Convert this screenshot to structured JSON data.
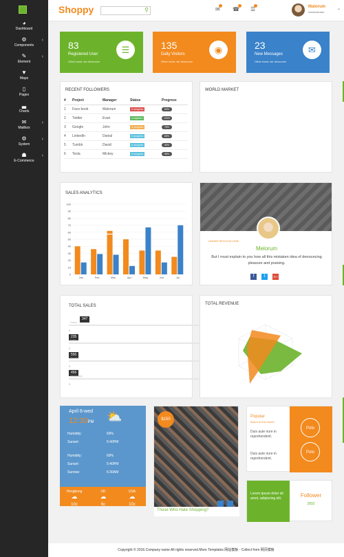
{
  "sidebar": {
    "items": [
      {
        "label": "Dashboard",
        "icon": "dashboard-icon",
        "glyph": "◕",
        "arrow": ""
      },
      {
        "label": "Components",
        "icon": "cogs-icon",
        "glyph": "⚙",
        "arrow": "›"
      },
      {
        "label": "Element",
        "icon": "pencil-icon",
        "glyph": "✎",
        "arrow": "›"
      },
      {
        "label": "Maps",
        "icon": "map-marker-icon",
        "glyph": "▼",
        "arrow": ""
      },
      {
        "label": "Pages",
        "icon": "file-icon",
        "glyph": "▯",
        "arrow": ""
      },
      {
        "label": "Charts",
        "icon": "bar-chart-icon",
        "glyph": "▃",
        "arrow": ""
      },
      {
        "label": "Mailbox",
        "icon": "envelope-icon",
        "glyph": "✉",
        "arrow": "›"
      },
      {
        "label": "System",
        "icon": "gear-icon",
        "glyph": "⚙",
        "arrow": "›"
      },
      {
        "label": "E-Commerce",
        "icon": "cart-icon",
        "glyph": "☗",
        "arrow": "›"
      }
    ]
  },
  "header": {
    "brand": "Shoppy",
    "search_placeholder": "",
    "user_name": "Malorum",
    "user_role": "Administrator"
  },
  "stats": [
    {
      "value": "83",
      "label": "Registered User",
      "sub": "Other hand, we denounce",
      "color": "#6cb32b",
      "icon": "file-text-icon",
      "glyph": "☰"
    },
    {
      "value": "135",
      "label": "Daily Visitors",
      "sub": "Other hand, we denounce",
      "color": "#f28a1e",
      "icon": "eye-icon",
      "glyph": "◉"
    },
    {
      "value": "23",
      "label": "New Messages",
      "sub": "Other hand, we denounce",
      "color": "#3a82c9",
      "icon": "envelope-icon",
      "glyph": "✉"
    }
  ],
  "followers": {
    "title": "RECENT FOLLOWERS",
    "headers": [
      "#",
      "Project",
      "Manager",
      "Status",
      "Progress"
    ],
    "rows": [
      {
        "n": "1",
        "project": "Face book",
        "manager": "Malorum",
        "status": "in progress",
        "status_color": "#d9534f",
        "progress": "60%"
      },
      {
        "n": "2",
        "project": "Twitter",
        "manager": "Evan",
        "status": "completed",
        "status_color": "#5cb85c",
        "progress": "100%"
      },
      {
        "n": "3",
        "project": "Google",
        "manager": "John",
        "status": "in progress",
        "status_color": "#f0ad4e",
        "progress": "75%"
      },
      {
        "n": "4",
        "project": "LinkedIn",
        "manager": "Danial",
        "status": "in progress",
        "status_color": "#5bc0de",
        "progress": "65%"
      },
      {
        "n": "5",
        "project": "Tumblr",
        "manager": "David",
        "status": "in progress",
        "status_color": "#5bc0de",
        "progress": "95%"
      },
      {
        "n": "6",
        "project": "Tesla",
        "manager": "Mickey",
        "status": "in progress",
        "status_color": "#5bc0de",
        "progress": "95%"
      }
    ]
  },
  "world_market": {
    "title": "WORLD MARKET"
  },
  "sales_analytics": {
    "title": "SALES ANALYTICS"
  },
  "profile": {
    "tag": "UNDER REVOLVE DDB",
    "name": "Melorum",
    "text": "But I must explain to you how all this mistaken idea of denouncing pleasure and praising.",
    "social": [
      "f",
      "t",
      "G+"
    ]
  },
  "total_sales": {
    "title": "TOTAL SALES",
    "sliders": [
      {
        "value": "347",
        "level": 0.063,
        "min": "0",
        "max": "550",
        "name": "Sales"
      },
      {
        "value": "235",
        "level": 0.0,
        "min": "0",
        "max": "550",
        "name": "Daily"
      },
      {
        "value": "550",
        "level": 0.0,
        "min": "0",
        "max": "550",
        "name": "Month"
      },
      {
        "value": "456",
        "level": 0.0,
        "min": "0",
        "max": "550",
        "name": "Yesterday"
      }
    ]
  },
  "total_revenue": {
    "title": "TOTAL REVENUE"
  },
  "weather": {
    "date": "April 6-wed",
    "time": "12:30",
    "time_suffix": "PM",
    "stats": [
      {
        "label": "Humidity:",
        "value": "69%"
      },
      {
        "label": "Sunset:",
        "value": "5:40PM"
      },
      {
        "label": "Humidity:",
        "value": "69%"
      },
      {
        "label": "Sunset:",
        "value": "5:40PM"
      },
      {
        "label": "Sunrise:",
        "value": "6:30AM"
      }
    ],
    "cities": [
      {
        "name": "Hongkong",
        "temp": "10c"
      },
      {
        "name": "UK",
        "temp": "6c"
      },
      {
        "name": "USA",
        "temp": "10c"
      }
    ]
  },
  "shopping": {
    "price": "$150",
    "caption": "Those Who Hate Shopping?"
  },
  "popular": {
    "title": "Popular",
    "sub": "Brand of this month",
    "text1": "Duis aute irure in reprehenderit.",
    "text2": "Duis aute irure in reprehenderit.",
    "badge1": "Polo",
    "badge2": "Polo"
  },
  "follower_card": {
    "text": "Lorem ipsum dolor sit amet, adipiscing elit.",
    "title": "Follower",
    "count": "2892"
  },
  "footer": {
    "text": "Copyright © 2016.Company name All rights reserved.More Templates 网站模板 - Collect from 网页模板"
  },
  "chart_data": [
    {
      "type": "bar",
      "title": "SALES ANALYTICS",
      "categories": [
        "Jan",
        "Feb",
        "Mar",
        "Apr",
        "May",
        "Jun",
        "Jul"
      ],
      "ylim": [
        0,
        100
      ],
      "yticks": [
        0,
        10,
        20,
        30,
        40,
        50,
        60,
        70,
        80,
        90,
        100
      ],
      "series": [
        {
          "values": [
            40,
            36,
            62,
            50,
            34,
            34,
            25
          ],
          "color": "#f28a1e"
        },
        {
          "values": [
            17,
            29,
            28,
            12,
            67,
            17,
            70
          ],
          "color": "#3a82c9"
        }
      ],
      "extra_bar": {
        "category": 2,
        "values": [
          58
        ],
        "color": "#f28a1e"
      }
    }
  ]
}
